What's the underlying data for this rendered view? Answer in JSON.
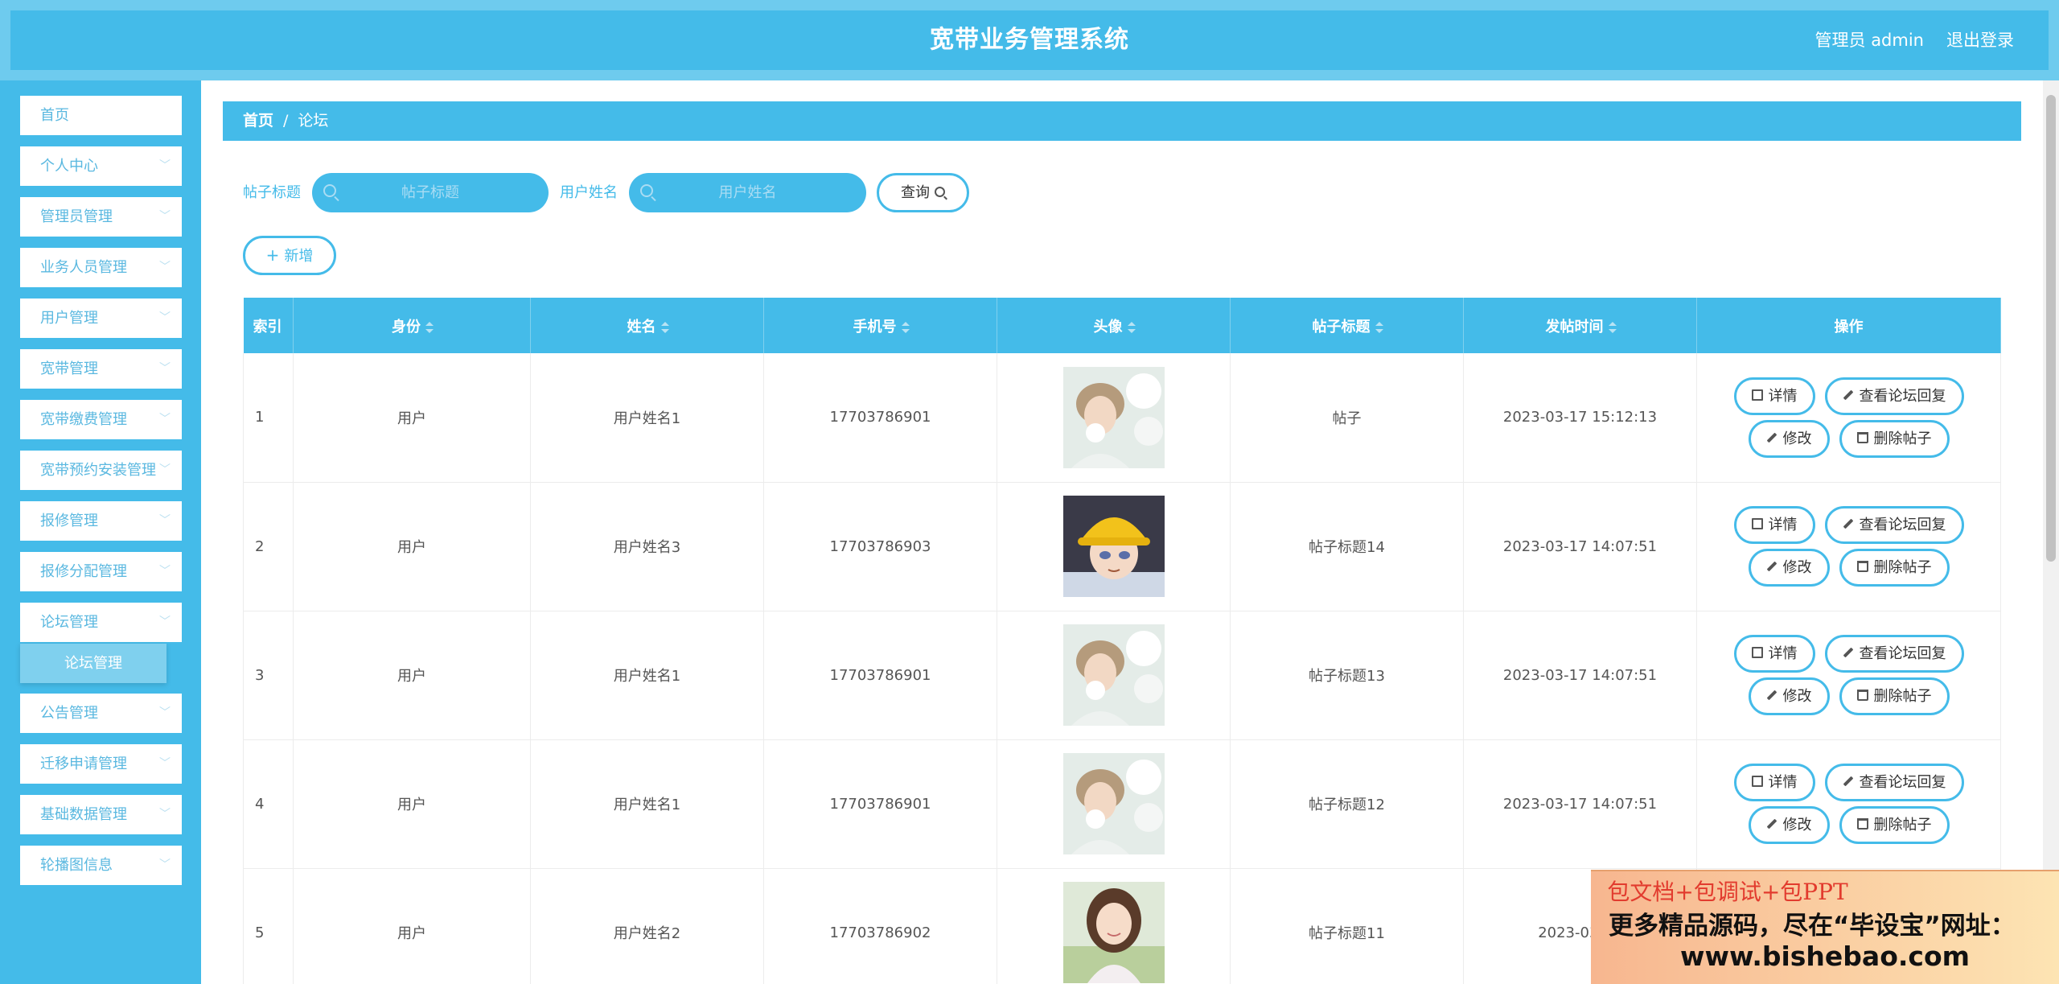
{
  "header": {
    "title": "宽带业务管理系统",
    "admin_label": "管理员 admin",
    "logout": "退出登录"
  },
  "sidebar": {
    "items": [
      {
        "label": "首页",
        "has_arrow": false
      },
      {
        "label": "个人中心",
        "has_arrow": true
      },
      {
        "label": "管理员管理",
        "has_arrow": true
      },
      {
        "label": "业务人员管理",
        "has_arrow": true
      },
      {
        "label": "用户管理",
        "has_arrow": true
      },
      {
        "label": "宽带管理",
        "has_arrow": true
      },
      {
        "label": "宽带缴费管理",
        "has_arrow": true
      },
      {
        "label": "宽带预约安装管理",
        "has_arrow": true
      },
      {
        "label": "报修管理",
        "has_arrow": true
      },
      {
        "label": "报修分配管理",
        "has_arrow": true
      },
      {
        "label": "论坛管理",
        "has_arrow": true
      },
      {
        "label": "公告管理",
        "has_arrow": true
      },
      {
        "label": "迁移申请管理",
        "has_arrow": true
      },
      {
        "label": "基础数据管理",
        "has_arrow": true
      },
      {
        "label": "轮播图信息",
        "has_arrow": true
      }
    ],
    "active_submenu": "论坛管理"
  },
  "breadcrumb": {
    "home": "首页",
    "separator": "/",
    "current": "论坛"
  },
  "filters": {
    "title_label": "帖子标题",
    "title_placeholder": "帖子标题",
    "user_label": "用户姓名",
    "user_placeholder": "用户姓名",
    "search_button": "查询",
    "add_button": "新增"
  },
  "table": {
    "columns": [
      "索引",
      "身份",
      "姓名",
      "手机号",
      "头像",
      "帖子标题",
      "发帖时间",
      "操作"
    ],
    "rows": [
      {
        "index": "1",
        "role": "用户",
        "name": "用户姓名1",
        "phone": "17703786901",
        "avatar": "avatar-boy-flowers",
        "post_title": "帖子",
        "time": "2023-03-17 15:12:13"
      },
      {
        "index": "2",
        "role": "用户",
        "name": "用户姓名3",
        "phone": "17703786903",
        "avatar": "avatar-anime-yellow-hat",
        "post_title": "帖子标题14",
        "time": "2023-03-17 14:07:51"
      },
      {
        "index": "3",
        "role": "用户",
        "name": "用户姓名1",
        "phone": "17703786901",
        "avatar": "avatar-boy-flowers",
        "post_title": "帖子标题13",
        "time": "2023-03-17 14:07:51"
      },
      {
        "index": "4",
        "role": "用户",
        "name": "用户姓名1",
        "phone": "17703786901",
        "avatar": "avatar-boy-flowers",
        "post_title": "帖子标题12",
        "time": "2023-03-17 14:07:51"
      },
      {
        "index": "5",
        "role": "用户",
        "name": "用户姓名2",
        "phone": "17703786902",
        "avatar": "avatar-girl-field",
        "post_title": "帖子标题11",
        "time": "2023-03-17"
      }
    ],
    "actions": {
      "detail": "详情",
      "view_replies": "查看论坛回复",
      "edit": "修改",
      "delete": "删除帖子"
    }
  },
  "ad": {
    "line1": "包文档+包调试+包PPT",
    "line2": "更多精品源码，尽在“毕设宝”网址：",
    "line3": "www.bishebao.com"
  },
  "colors": {
    "primary": "#44bbe9",
    "header_outer": "#6ecbee",
    "ad_text_red": "#e23b2e"
  }
}
